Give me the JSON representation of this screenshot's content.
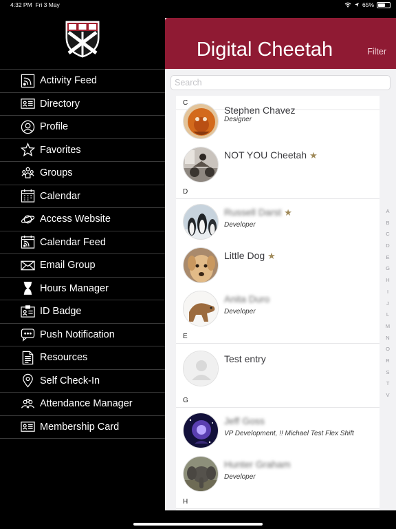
{
  "status": {
    "time": "4:32 PM",
    "date": "Fri 3 May",
    "battery": "65%",
    "battery_level": 0.65
  },
  "app": {
    "title": "Digital Cheetah",
    "filter_label": "Filter"
  },
  "search": {
    "placeholder": "Search"
  },
  "menu": [
    {
      "label": "Activity Feed",
      "icon": "rss-icon"
    },
    {
      "label": "Directory",
      "icon": "id-card-icon"
    },
    {
      "label": "Profile",
      "icon": "profile-icon"
    },
    {
      "label": "Favorites",
      "icon": "star-icon"
    },
    {
      "label": "Groups",
      "icon": "groups-icon"
    },
    {
      "label": "Calendar",
      "icon": "calendar-icon"
    },
    {
      "label": "Access Website",
      "icon": "planet-icon"
    },
    {
      "label": "Calendar Feed",
      "icon": "calendar-feed-icon"
    },
    {
      "label": "Email Group",
      "icon": "envelope-icon"
    },
    {
      "label": "Hours Manager",
      "icon": "hourglass-icon"
    },
    {
      "label": "ID Badge",
      "icon": "badge-icon"
    },
    {
      "label": "Push Notification",
      "icon": "chat-bubble-icon"
    },
    {
      "label": "Resources",
      "icon": "document-icon"
    },
    {
      "label": "Self Check-In",
      "icon": "location-pin-icon"
    },
    {
      "label": "Attendance Manager",
      "icon": "people-icon"
    },
    {
      "label": "Membership Card",
      "icon": "membership-card-icon"
    }
  ],
  "directory": {
    "sections": [
      {
        "letter": "C",
        "entries": [
          {
            "name": "Stephen Chavez",
            "role": "Designer",
            "favorite": false,
            "blurred": false,
            "avatar": "orange-creature"
          },
          {
            "name": "NOT YOU Cheetah",
            "role": "",
            "favorite": true,
            "blurred": false,
            "avatar": "motorcycle"
          }
        ]
      },
      {
        "letter": "D",
        "entries": [
          {
            "name": "Russell Darst",
            "role": "Developer",
            "favorite": true,
            "blurred": true,
            "avatar": "penguins"
          },
          {
            "name": "Little Dog",
            "role": "",
            "favorite": true,
            "blurred": false,
            "avatar": "dog"
          },
          {
            "name": "Anita Duro",
            "role": "Developer",
            "favorite": false,
            "blurred": true,
            "avatar": "dog-sculpture"
          }
        ]
      },
      {
        "letter": "E",
        "entries": [
          {
            "name": "Test entry",
            "role": "",
            "favorite": false,
            "blurred": false,
            "avatar": "placeholder"
          }
        ]
      },
      {
        "letter": "G",
        "entries": [
          {
            "name": "Jeff Goss",
            "role": "VP Development, !! Michael Test Flex Shift",
            "favorite": false,
            "blurred": true,
            "avatar": "galaxy"
          },
          {
            "name": "Hunter Graham",
            "role": "Developer",
            "favorite": false,
            "blurred": true,
            "avatar": "elephant"
          }
        ]
      },
      {
        "letter": "H",
        "entries": []
      }
    ],
    "index": [
      "A",
      "B",
      "C",
      "D",
      "E",
      "G",
      "H",
      "I",
      "J",
      "L",
      "M",
      "N",
      "O",
      "R",
      "S",
      "T",
      "V"
    ]
  },
  "colors": {
    "header": "#8f1a33",
    "accent_star": "#a08a5a"
  }
}
